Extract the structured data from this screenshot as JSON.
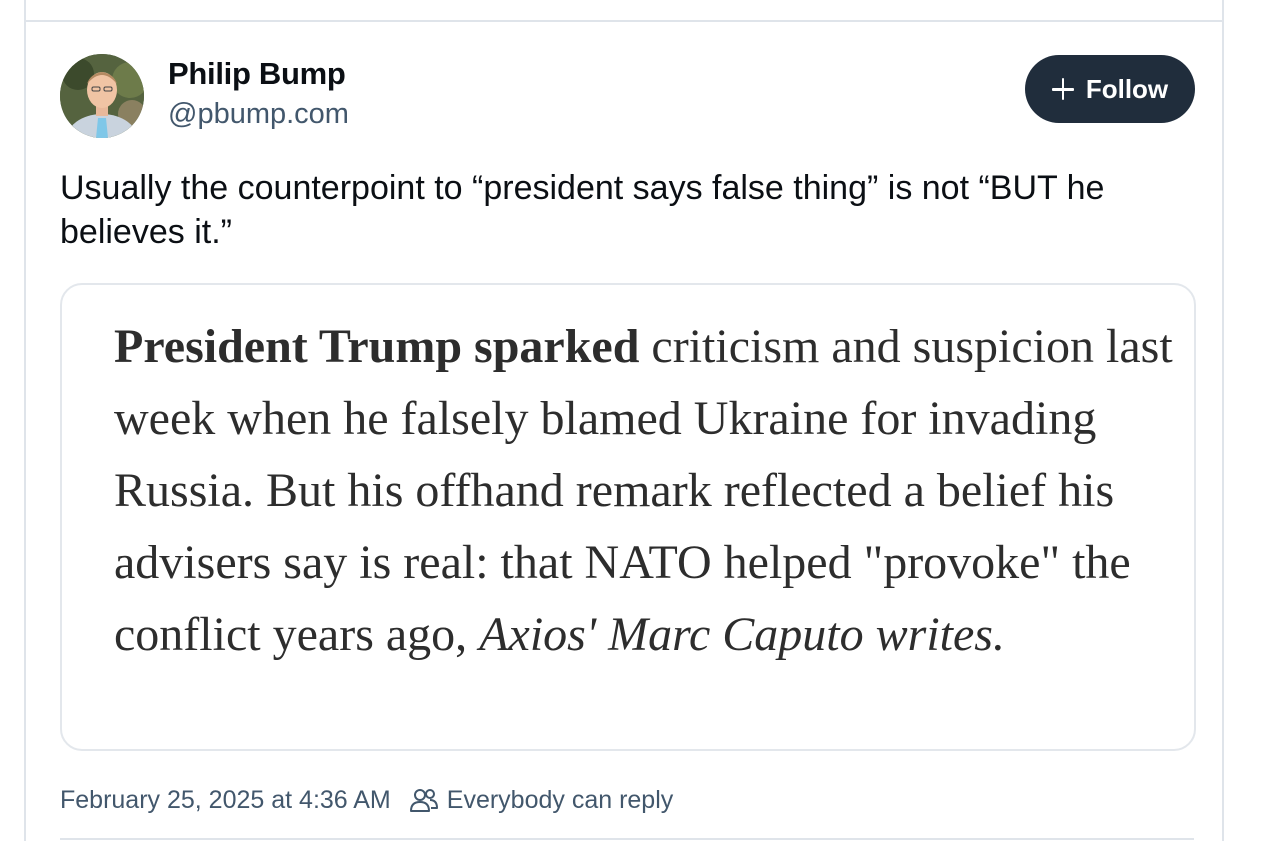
{
  "author": {
    "name": "Philip Bump",
    "handle": "@pbump.com"
  },
  "follow_button": {
    "label": "Follow",
    "icon": "plus-icon"
  },
  "post": {
    "text": "Usually the counterpoint to “president says false thing” is not “BUT he believes it.”"
  },
  "quoted_image": {
    "bold_lead": "President Trump sparked",
    "body": " criticism and suspicion last week when he falsely blamed Ukraine for invading Russia. But his offhand remark reflected a belief his advisers say is real: that NATO helped \"provoke\" the conflict years ago, ",
    "italic_tail": "Axios' Marc Caputo writes."
  },
  "meta": {
    "timestamp": "February 25, 2025 at 4:36 AM",
    "reply_icon": "people-icon",
    "reply_setting": "Everybody can reply"
  },
  "colors": {
    "follow_bg": "#202d3c",
    "muted_text": "#42576c",
    "border": "#dfe4ea"
  }
}
